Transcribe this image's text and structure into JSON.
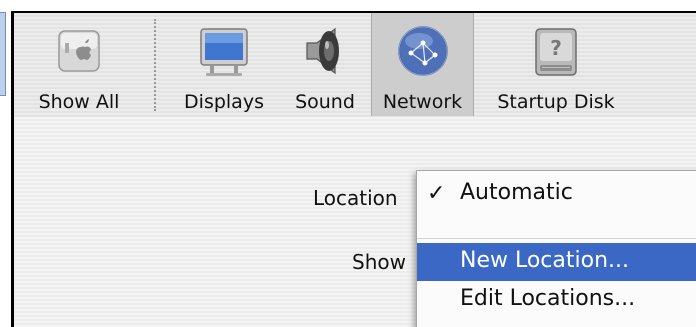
{
  "toolbar": {
    "items": [
      {
        "label": "Show All",
        "icon": "apple-switch-icon"
      },
      {
        "label": "Displays",
        "icon": "display-icon"
      },
      {
        "label": "Sound",
        "icon": "speaker-icon"
      },
      {
        "label": "Network",
        "icon": "network-globe-icon"
      },
      {
        "label": "Startup Disk",
        "icon": "hard-disk-icon"
      }
    ],
    "selected": "Network"
  },
  "form": {
    "location_label": "Location",
    "show_label": "Show"
  },
  "location_menu": {
    "items": [
      {
        "label": "Automatic",
        "checked": true
      },
      {
        "label": "New Location...",
        "highlighted": true
      },
      {
        "label": "Edit Locations..."
      }
    ],
    "check_glyph": "✓"
  },
  "colors": {
    "highlight": "#3b68c4",
    "toolbar_bg": "#e9e9e9",
    "window_border": "#000000"
  }
}
